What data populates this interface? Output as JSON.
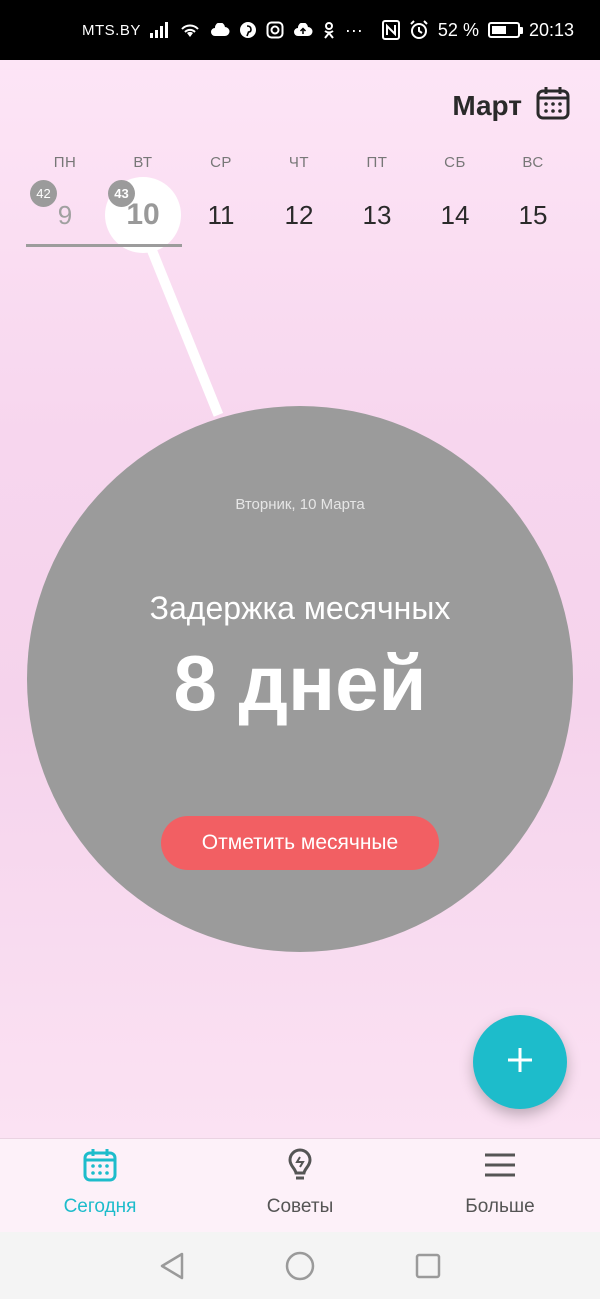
{
  "status_bar": {
    "carrier": "MTS.BY",
    "battery_text": "52 %",
    "time": "20:13",
    "more_indicator": "···"
  },
  "header": {
    "month": "Март"
  },
  "week": {
    "days": [
      "ПН",
      "ВТ",
      "СР",
      "ЧТ",
      "ПТ",
      "СБ",
      "ВС"
    ],
    "dates": [
      {
        "num": "9",
        "badge": "42",
        "state": "past"
      },
      {
        "num": "10",
        "badge": "43",
        "state": "today"
      },
      {
        "num": "11",
        "badge": "",
        "state": "future"
      },
      {
        "num": "12",
        "badge": "",
        "state": "future"
      },
      {
        "num": "13",
        "badge": "",
        "state": "future"
      },
      {
        "num": "14",
        "badge": "",
        "state": "future"
      },
      {
        "num": "15",
        "badge": "",
        "state": "future"
      }
    ]
  },
  "circle": {
    "date": "Вторник, 10 Марта",
    "label": "Задержка месячных",
    "value": "8 дней",
    "button": "Отметить месячные"
  },
  "fab": {
    "symbol": "+"
  },
  "bottom_nav": {
    "items": [
      {
        "label": "Сегодня",
        "icon": "calendar-icon",
        "active": true
      },
      {
        "label": "Советы",
        "icon": "lightbulb-icon",
        "active": false
      },
      {
        "label": "Больше",
        "icon": "menu-icon",
        "active": false
      }
    ]
  },
  "colors": {
    "accent": "#1dbccb",
    "button": "#f25f63",
    "circle": "#9b9b9b",
    "background": "#f7d6ee"
  }
}
